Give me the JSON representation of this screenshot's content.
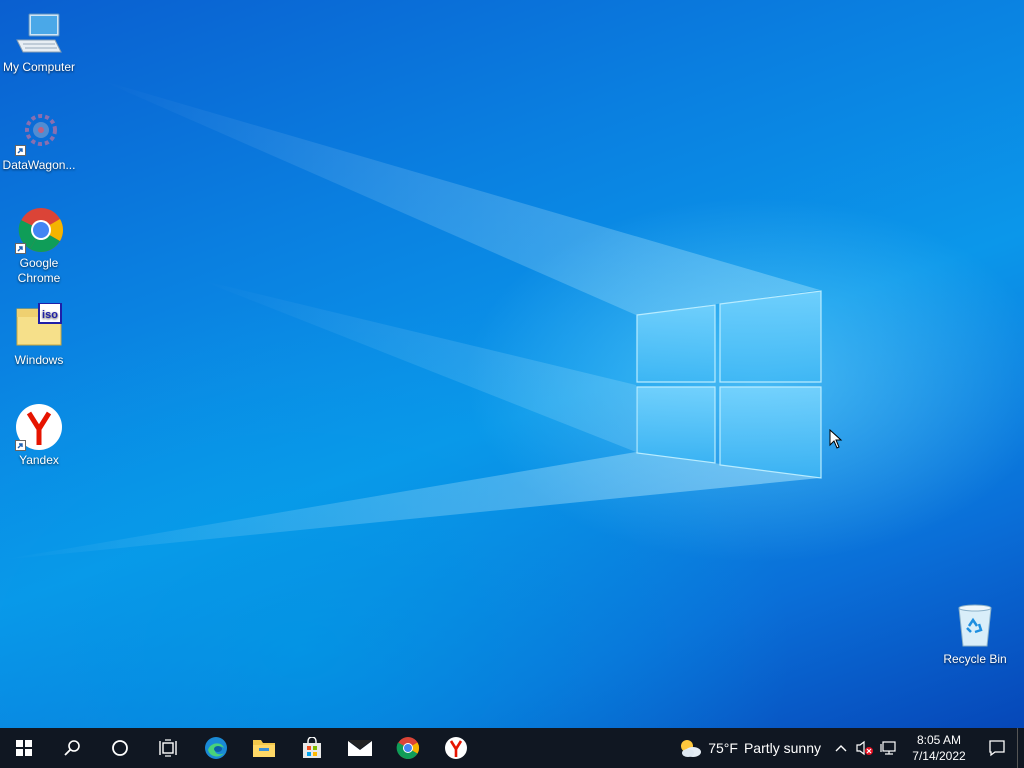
{
  "desktop": {
    "icons": [
      {
        "label": "My Computer",
        "icon": "computer-icon"
      },
      {
        "label": "DataWagon...",
        "icon": "datawagon-icon"
      },
      {
        "label": "Google Chrome",
        "icon": "chrome-icon"
      },
      {
        "label": "Windows",
        "icon": "iso-file-icon"
      },
      {
        "label": "Yandex",
        "icon": "yandex-icon"
      },
      {
        "label": "Recycle Bin",
        "icon": "recycle-bin-icon"
      }
    ]
  },
  "taskbar": {
    "pinned": [
      "start-icon",
      "search-icon",
      "cortana-icon",
      "task-view-icon",
      "edge-icon",
      "file-explorer-icon",
      "store-icon",
      "mail-icon",
      "chrome-icon",
      "yandex-icon"
    ],
    "weather": {
      "temp": "75°F",
      "condition": "Partly sunny"
    },
    "clock": {
      "time": "8:05 AM",
      "date": "7/14/2022"
    }
  },
  "colors": {
    "taskbar": "#101722",
    "desktop_accent": "#0a7fe0"
  }
}
